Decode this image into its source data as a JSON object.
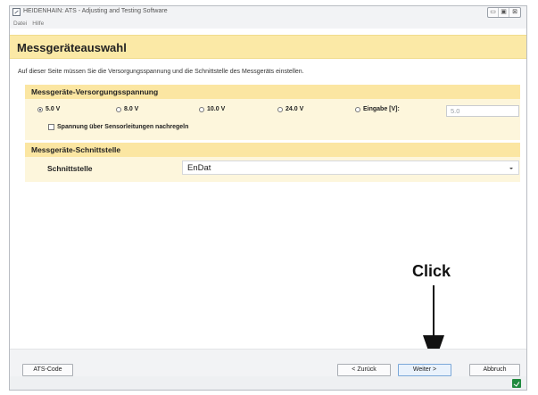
{
  "window": {
    "title": "HEIDENHAIN: ATS - Adjusting and Testing Software",
    "controls": [
      "▭",
      "▣",
      "⊠"
    ]
  },
  "menu": [
    "Datei",
    "Hilfe"
  ],
  "page": {
    "title": "Messgeräteauswahl",
    "intro": "Auf dieser Seite müssen Sie die Versorgungsspannung und die Schnittstelle des Messgeräts einstellen."
  },
  "supply": {
    "heading": "Messgeräte-Versorgungsspannung",
    "options": [
      {
        "label": "5.0 V",
        "checked": true
      },
      {
        "label": "8.0 V",
        "checked": false
      },
      {
        "label": "10.0 V",
        "checked": false
      },
      {
        "label": "24.0 V",
        "checked": false
      },
      {
        "label": "Eingabe [V]:",
        "checked": false
      }
    ],
    "input_value": "5.0",
    "sense_label": "Spannung über Sensorleitungen nachregeln",
    "sense_checked": false
  },
  "interface": {
    "heading": "Messgeräte-Schnittstelle",
    "label": "Schnittstelle",
    "value": "EnDat"
  },
  "annotation": {
    "text": "Click"
  },
  "footer": {
    "ats_code": "ATS-Code",
    "back": "< Zurück",
    "next": "Weiter >",
    "abort": "Abbruch"
  }
}
